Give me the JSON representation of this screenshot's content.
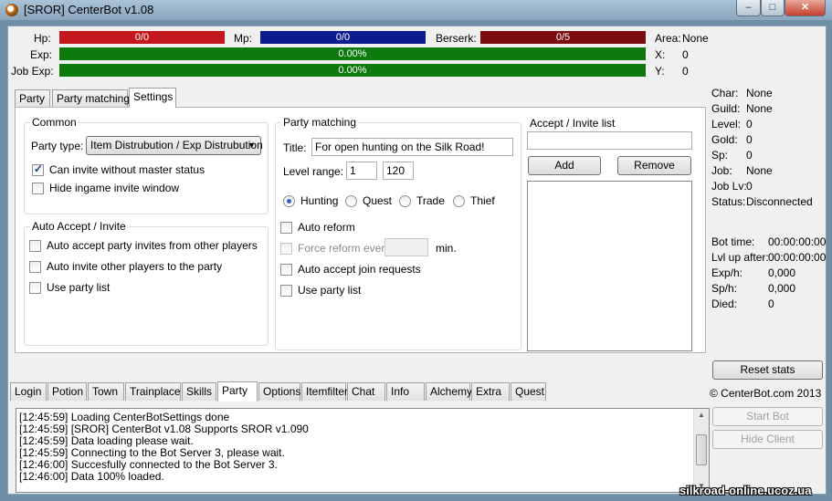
{
  "window": {
    "title": "[SROR] CenterBot v1.08",
    "controls": {
      "minimize": "–",
      "maximize": "□",
      "close": "✕"
    }
  },
  "stats_bars": {
    "hp": {
      "label": "Hp:",
      "value": "0/0"
    },
    "mp": {
      "label": "Mp:",
      "value": "0/0"
    },
    "berserk": {
      "label": "Berserk:",
      "value": "0/5"
    },
    "exp": {
      "label": "Exp:",
      "value": "0.00%"
    },
    "job_exp": {
      "label": "Job Exp:",
      "value": "0.00%"
    }
  },
  "location": {
    "area_label": "Area:",
    "area_value": "None",
    "x_label": "X:",
    "x_value": "0",
    "y_label": "Y:",
    "y_value": "0"
  },
  "char_info": [
    {
      "label": "Char:",
      "value": "None"
    },
    {
      "label": "Guild:",
      "value": "None"
    },
    {
      "label": "Level:",
      "value": "0"
    },
    {
      "label": "Gold:",
      "value": "0"
    },
    {
      "label": "Sp:",
      "value": "0"
    },
    {
      "label": "Job:",
      "value": "None"
    },
    {
      "label": "Job Lv:",
      "value": "0"
    },
    {
      "label": "Status:",
      "value": "Disconnected"
    }
  ],
  "bot_stats": [
    {
      "label": "Bot time:",
      "value": "00:00:00:00"
    },
    {
      "label": "Lvl up after:",
      "value": "00:00:00:00"
    },
    {
      "label": "Exp/h:",
      "value": "0,000"
    },
    {
      "label": "Sp/h:",
      "value": "0,000"
    },
    {
      "label": "Died:",
      "value": "0"
    }
  ],
  "right_buttons": {
    "reset_stats": "Reset stats",
    "copyright": "© CenterBot.com 2013",
    "start_bot": "Start Bot",
    "hide_client": "Hide Client"
  },
  "inner_tabs": [
    "Party",
    "Party matching",
    "Settings"
  ],
  "common": {
    "title": "Common",
    "party_type_label": "Party type:",
    "party_type_value": "Item Distrubution / Exp Distrubution",
    "can_invite": "Can invite without master status",
    "hide_invite": "Hide ingame invite window"
  },
  "auto_accept": {
    "title": "Auto Accept / Invite",
    "accept_invites": "Auto accept party invites from other players",
    "invite_others": "Auto invite other players to the party",
    "use_list": "Use party list"
  },
  "party_matching": {
    "title": "Party matching",
    "title_label": "Title:",
    "title_value": "For open hunting on the Silk Road!",
    "level_range_label": "Level range:",
    "level_min": "1",
    "level_max": "120",
    "purposes": [
      "Hunting",
      "Quest",
      "Trade",
      "Thief"
    ],
    "auto_reform": "Auto reform",
    "force_reform": "Force reform every:",
    "force_reform_unit": "min.",
    "auto_accept_join": "Auto accept join requests",
    "use_list": "Use party list"
  },
  "accept_invite_list": {
    "title": "Accept / Invite list",
    "add": "Add",
    "remove": "Remove"
  },
  "main_tabs": [
    "Login",
    "Potion",
    "Town",
    "Trainplace",
    "Skills",
    "Party",
    "Options",
    "Itemfilter",
    "Chat",
    "Info",
    "Alchemy",
    "Extra",
    "Quest"
  ],
  "log": [
    "[12:45:59] Loading CenterBotSettings done",
    "[12:45:59] [SROR] CenterBot v1.08 Supports SROR v1.090",
    "[12:45:59] Data loading please wait.",
    "[12:45:59] Connecting to the Bot Server 3, please wait.",
    "[12:46:00] Succesfully connected to the Bot Server 3.",
    "[12:46:00] Data 100% loaded."
  ],
  "watermark": "silkroad-online.ucoz.ua"
}
